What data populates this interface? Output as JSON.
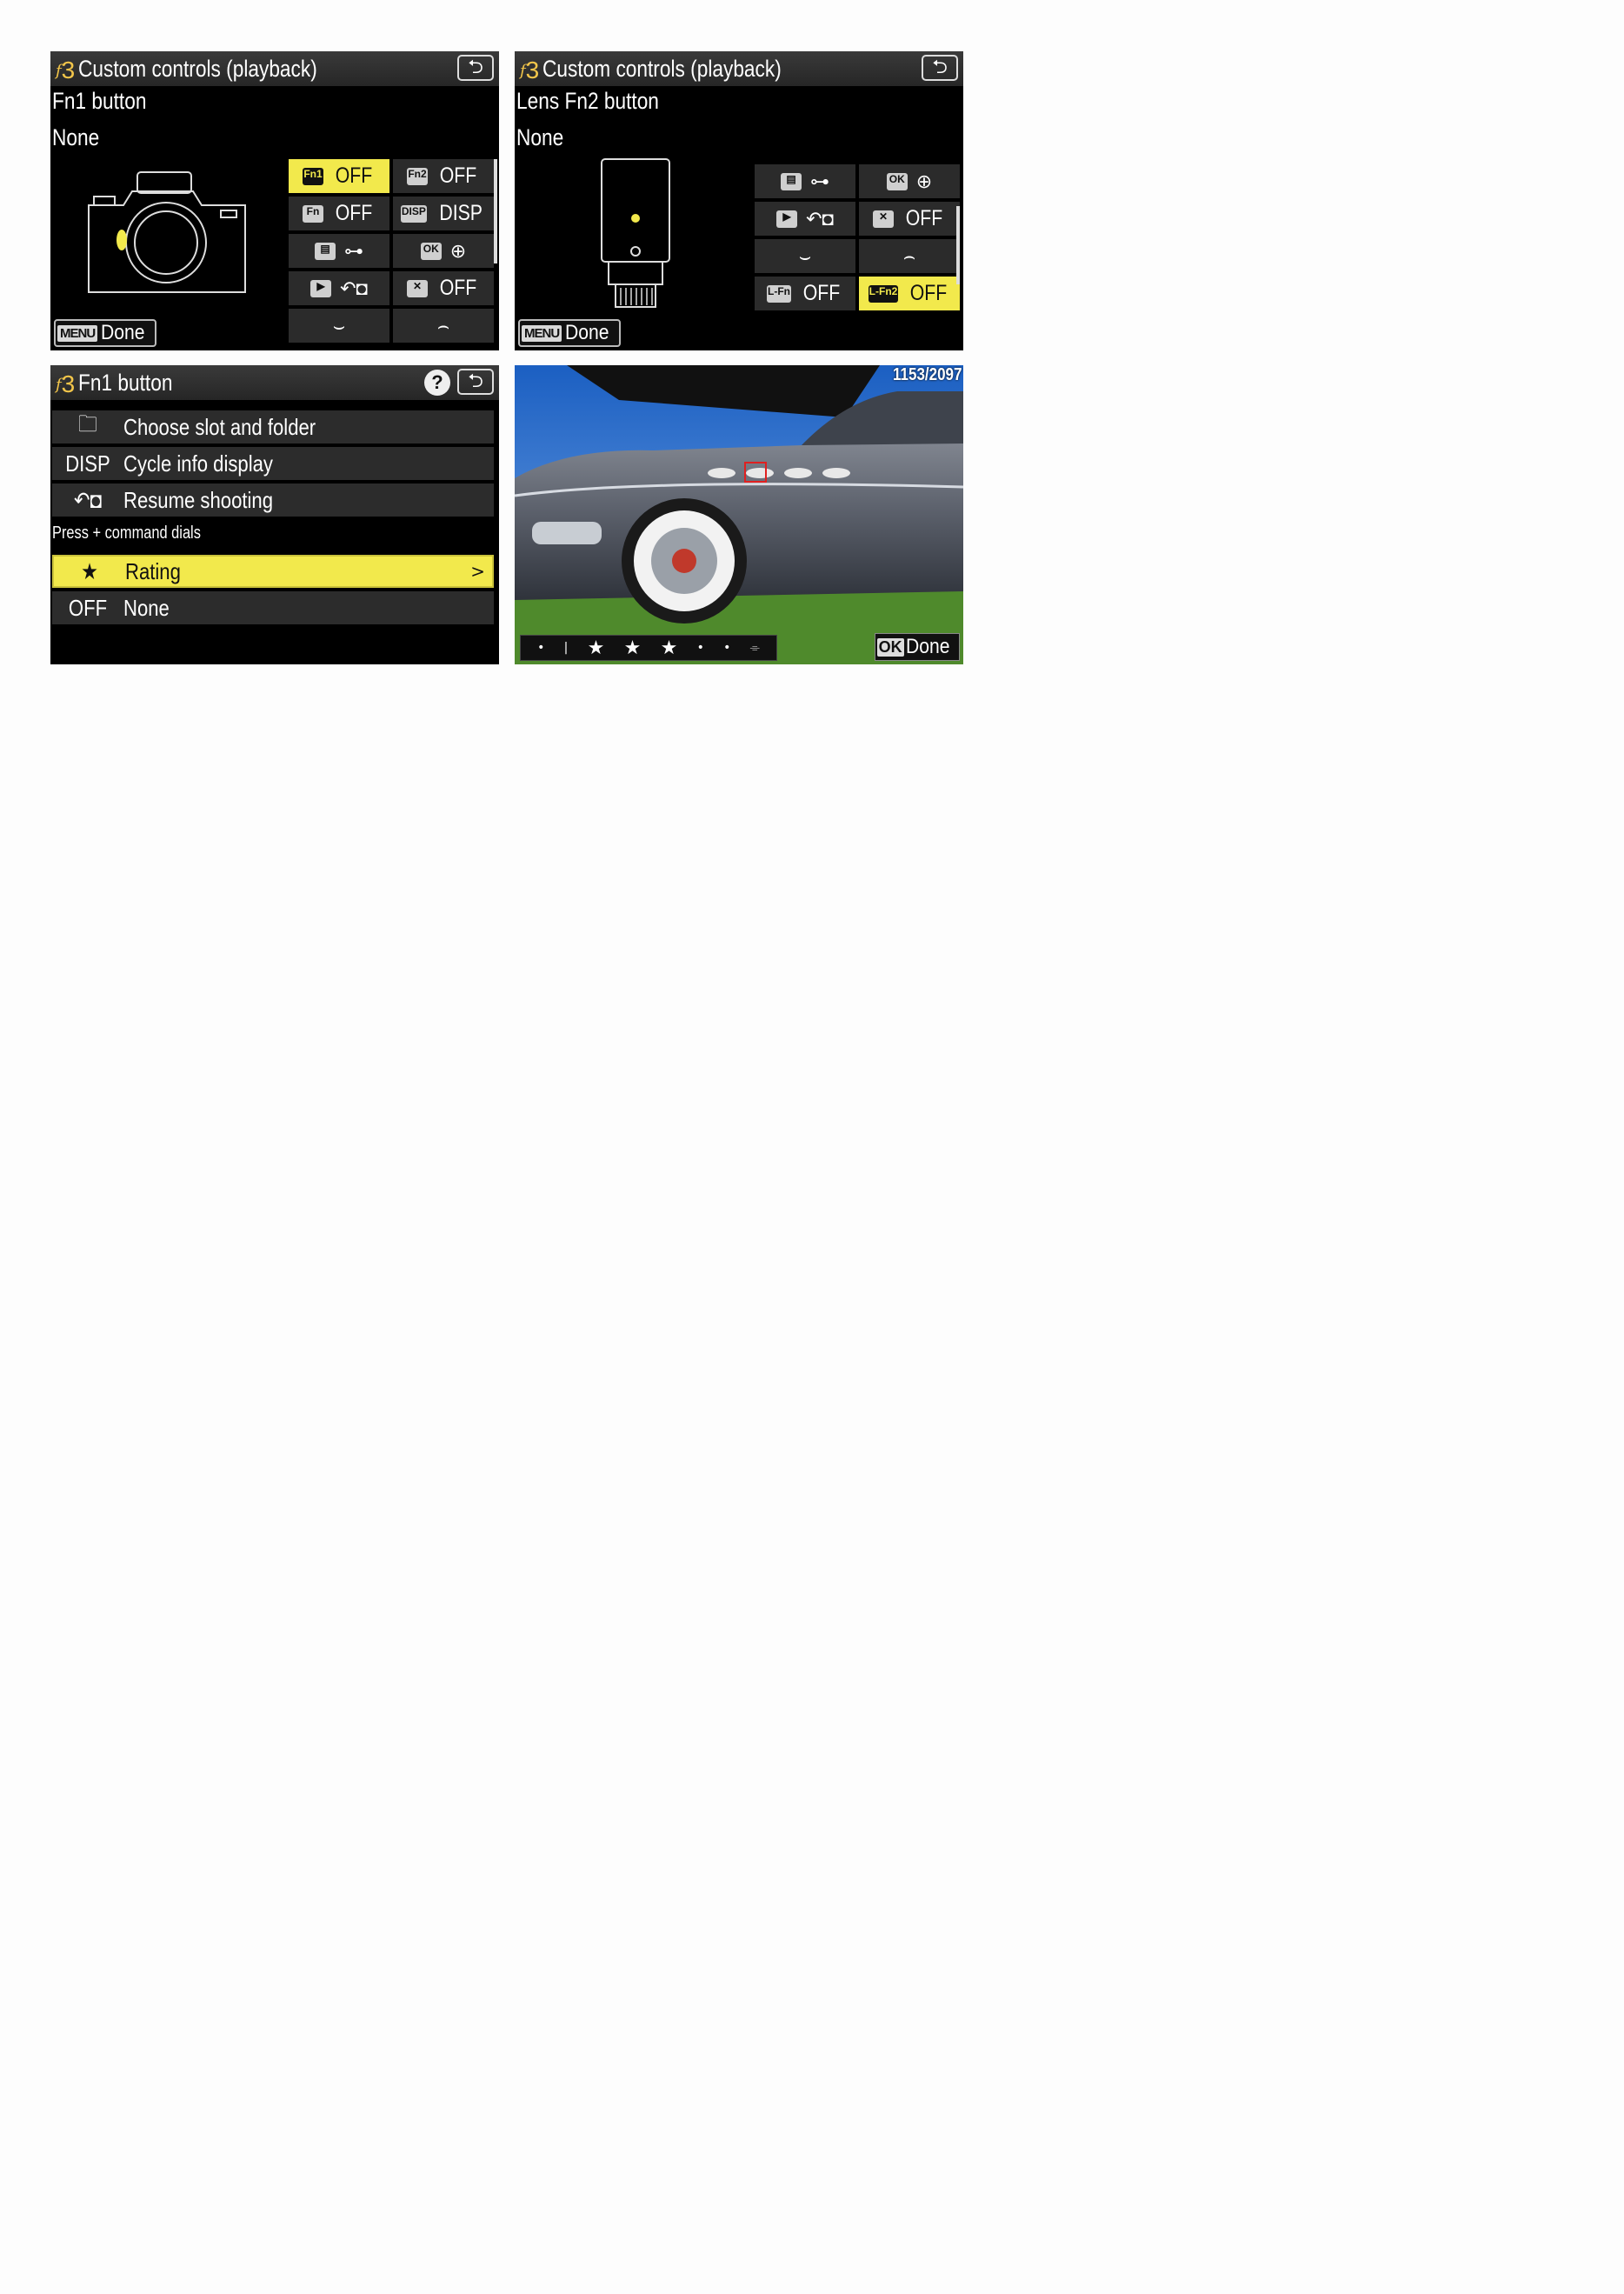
{
  "panels": {
    "p1": {
      "menu_code": "3",
      "title": "Custom controls (playback)",
      "control_name": "Fn1 button",
      "assignment": "None",
      "done_key": "MENU",
      "done_label": "Done",
      "grid": [
        {
          "icon": "Fn1",
          "value": "OFF",
          "selected": true
        },
        {
          "icon": "Fn2",
          "value": "OFF"
        },
        {
          "icon": "Fn",
          "value": "OFF"
        },
        {
          "icon": "DISP",
          "value": "DISP"
        },
        {
          "icon": "menu-icon",
          "value": "key-icon"
        },
        {
          "icon": "OK",
          "value": "zoom-icon"
        },
        {
          "icon": "play-icon",
          "value": "resume-shooting-icon"
        },
        {
          "icon": "protect-icon",
          "value": "OFF"
        },
        {
          "icon": "",
          "value": "main-dial-icon"
        },
        {
          "icon": "",
          "value": "sub-dial-icon"
        }
      ]
    },
    "p2": {
      "menu_code": "3",
      "title": "Custom controls (playback)",
      "control_name": "Lens Fn2 button",
      "assignment": "None",
      "done_key": "MENU",
      "done_label": "Done",
      "grid": [
        {
          "icon": "menu-icon",
          "value": "key-icon"
        },
        {
          "icon": "OK",
          "value": "zoom-icon"
        },
        {
          "icon": "play-icon",
          "value": "resume-shooting-icon"
        },
        {
          "icon": "protect-icon",
          "value": "OFF"
        },
        {
          "icon": "",
          "value": "main-dial-icon"
        },
        {
          "icon": "",
          "value": "sub-dial-icon"
        },
        {
          "icon": "L-Fn",
          "value": "OFF"
        },
        {
          "icon": "L-Fn2",
          "value": "OFF",
          "selected": true
        }
      ]
    },
    "p3": {
      "menu_code": "3",
      "title": "Fn1 button",
      "help": "?",
      "items": [
        {
          "icon": "folder-icon",
          "label": "Choose slot and folder"
        },
        {
          "icon": "DISP",
          "label": "Cycle info display"
        },
        {
          "icon": "resume-shooting-icon",
          "label": "Resume shooting"
        }
      ],
      "section": "Press + command dials",
      "items2": [
        {
          "icon": "★",
          "label": "Rating",
          "selected": true,
          "arrow": ">"
        },
        {
          "icon": "OFF",
          "label": "None"
        }
      ]
    },
    "p4": {
      "counter": "1153/2097",
      "rating_stars": 3,
      "ok_key": "OK",
      "done_label": "Done"
    }
  }
}
